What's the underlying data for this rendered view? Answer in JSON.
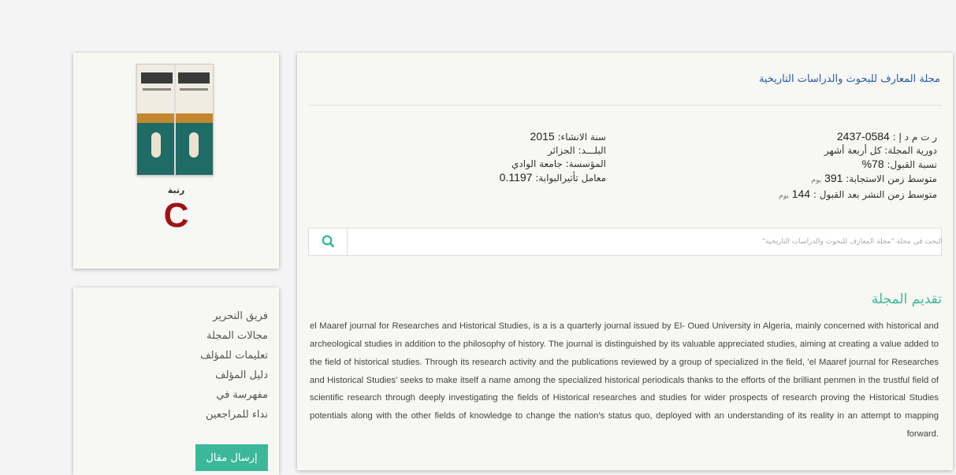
{
  "cover": {
    "rank_label": "رتبة",
    "rank_value": "C"
  },
  "menu": {
    "items": [
      "فريق التحرير",
      "مجالات المجلة",
      "تعليمات للمؤلف",
      "دليل المؤلف",
      "مفهرسة في",
      "نداء للمراجعين"
    ],
    "submit_label": "إرسال مقال"
  },
  "journal": {
    "title": "مجلة المعارف للبحوث والدراسات التاريخية",
    "info_right": [
      {
        "label": "ر ت م د إ : ",
        "value": "0584-2437",
        "unit": ""
      },
      {
        "label": "دورية المجلة: كل أربعة أشهر",
        "value": "",
        "unit": ""
      },
      {
        "label": "نسبة القبول: ",
        "value": "78%",
        "unit": ""
      },
      {
        "label": "متوسط زمن الاستجابة: ",
        "value": "391",
        "unit": "يوم"
      },
      {
        "label": "متوسط زمن النشر بعد القبول : ",
        "value": "144",
        "unit": "يوم"
      }
    ],
    "info_left": [
      {
        "label": "سنة الانشاء: ",
        "value": "2015",
        "unit": ""
      },
      {
        "label": "البلـــد: الجزائر",
        "value": "",
        "unit": ""
      },
      {
        "label": "المؤسسة: جامعة الوادي",
        "value": "",
        "unit": ""
      },
      {
        "label": "معامل تأثيرالبوابة: ",
        "value": "0.1197",
        "unit": ""
      }
    ]
  },
  "search": {
    "placeholder": "البحث في مجلة \"مجلة المعارف للبحوث والدراسات التاريخية\"",
    "icon": "search-icon"
  },
  "intro": {
    "heading": "تقديم المجلة",
    "text": "el Maaref journal for Researches and Historical Studies, is a is a quarterly journal issued by El- Oued University in Algeria, mainly concerned with historical and archeological studies in addition to the philosophy of history. The journal is distinguished by its valuable appreciated studies, aiming at creating a value added to the field of historical studies. Through its research activity and the publications reviewed by a group of specialized in the field, 'el Maaref journal for Researches and Historical Studies' seeks to make itself a name among the specialized historical periodicals thanks to the efforts of the brilliant penmen in the trustful field of scientific research through deeply investigating the fields of Historical researches and studies for wider prospects of research proving the Historical Studies potentials along with the other fields of knowledge to change the nation's status quo, deployed with an understanding of its reality in an attempt to mapping forward."
  },
  "colors": {
    "accent": "#3bb89a",
    "title_blue": "#2a5ca8",
    "rank_red": "#a11313"
  }
}
